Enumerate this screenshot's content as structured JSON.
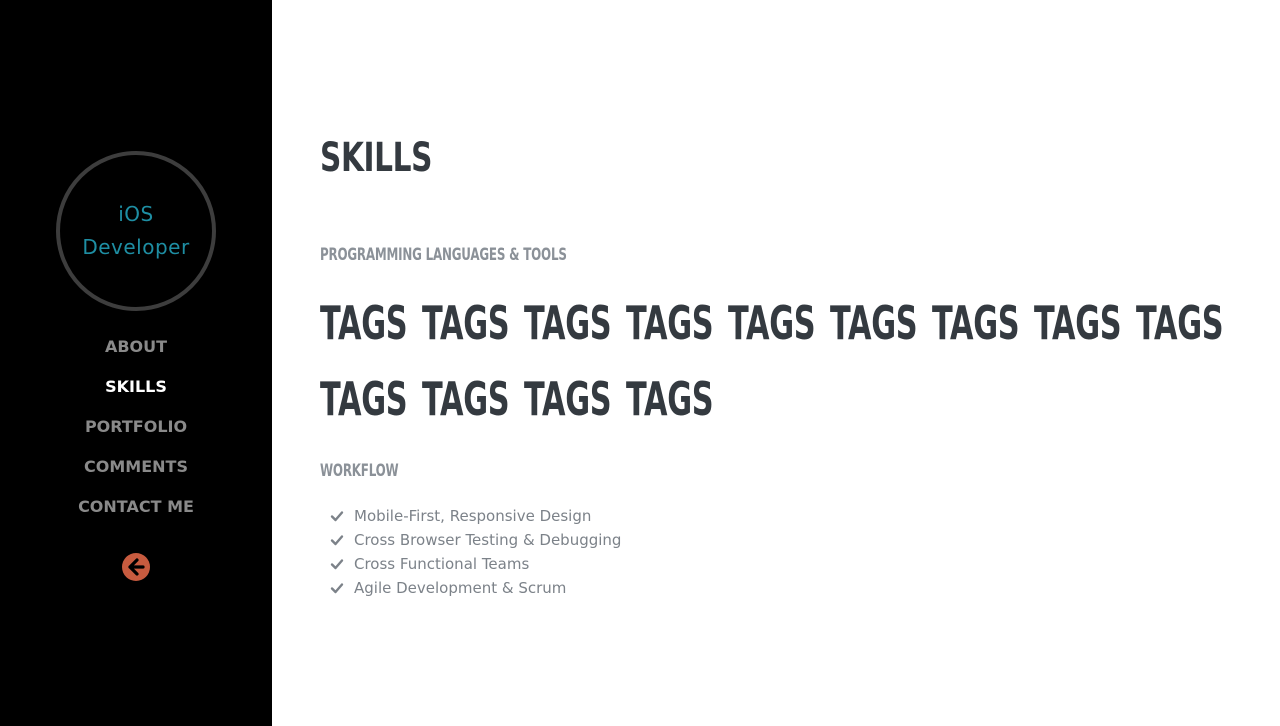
{
  "avatar": {
    "line1": "iOS",
    "line2": "Developer"
  },
  "nav": {
    "items": [
      {
        "label": "ABOUT"
      },
      {
        "label": "SKILLS",
        "active": true
      },
      {
        "label": "PORTFOLIO"
      },
      {
        "label": "COMMENTS"
      },
      {
        "label": "CONTACT ME"
      }
    ],
    "back_icon": "arrow-left-circle-icon"
  },
  "main": {
    "title": "SKILLS",
    "tools_heading": "PROGRAMMING LANGUAGES & TOOLS",
    "tags": [
      "TAGS",
      "TAGS",
      "TAGS",
      "TAGS",
      "TAGS",
      "TAGS",
      "TAGS",
      "TAGS",
      "TAGS",
      "TAGS",
      "TAGS",
      "TAGS",
      "TAGS"
    ],
    "workflow_heading": "WORKFLOW",
    "workflow_items": [
      "Mobile-First, Responsive Design",
      "Cross Browser Testing & Debugging",
      "Cross Functional Teams",
      "Agile Development & Scrum"
    ]
  },
  "colors": {
    "sidebar_bg": "#000000",
    "accent_teal": "#1e8ea3",
    "back_button": "#c75b3f",
    "heading_dark": "#343a40",
    "muted_gray": "#8b9198"
  }
}
